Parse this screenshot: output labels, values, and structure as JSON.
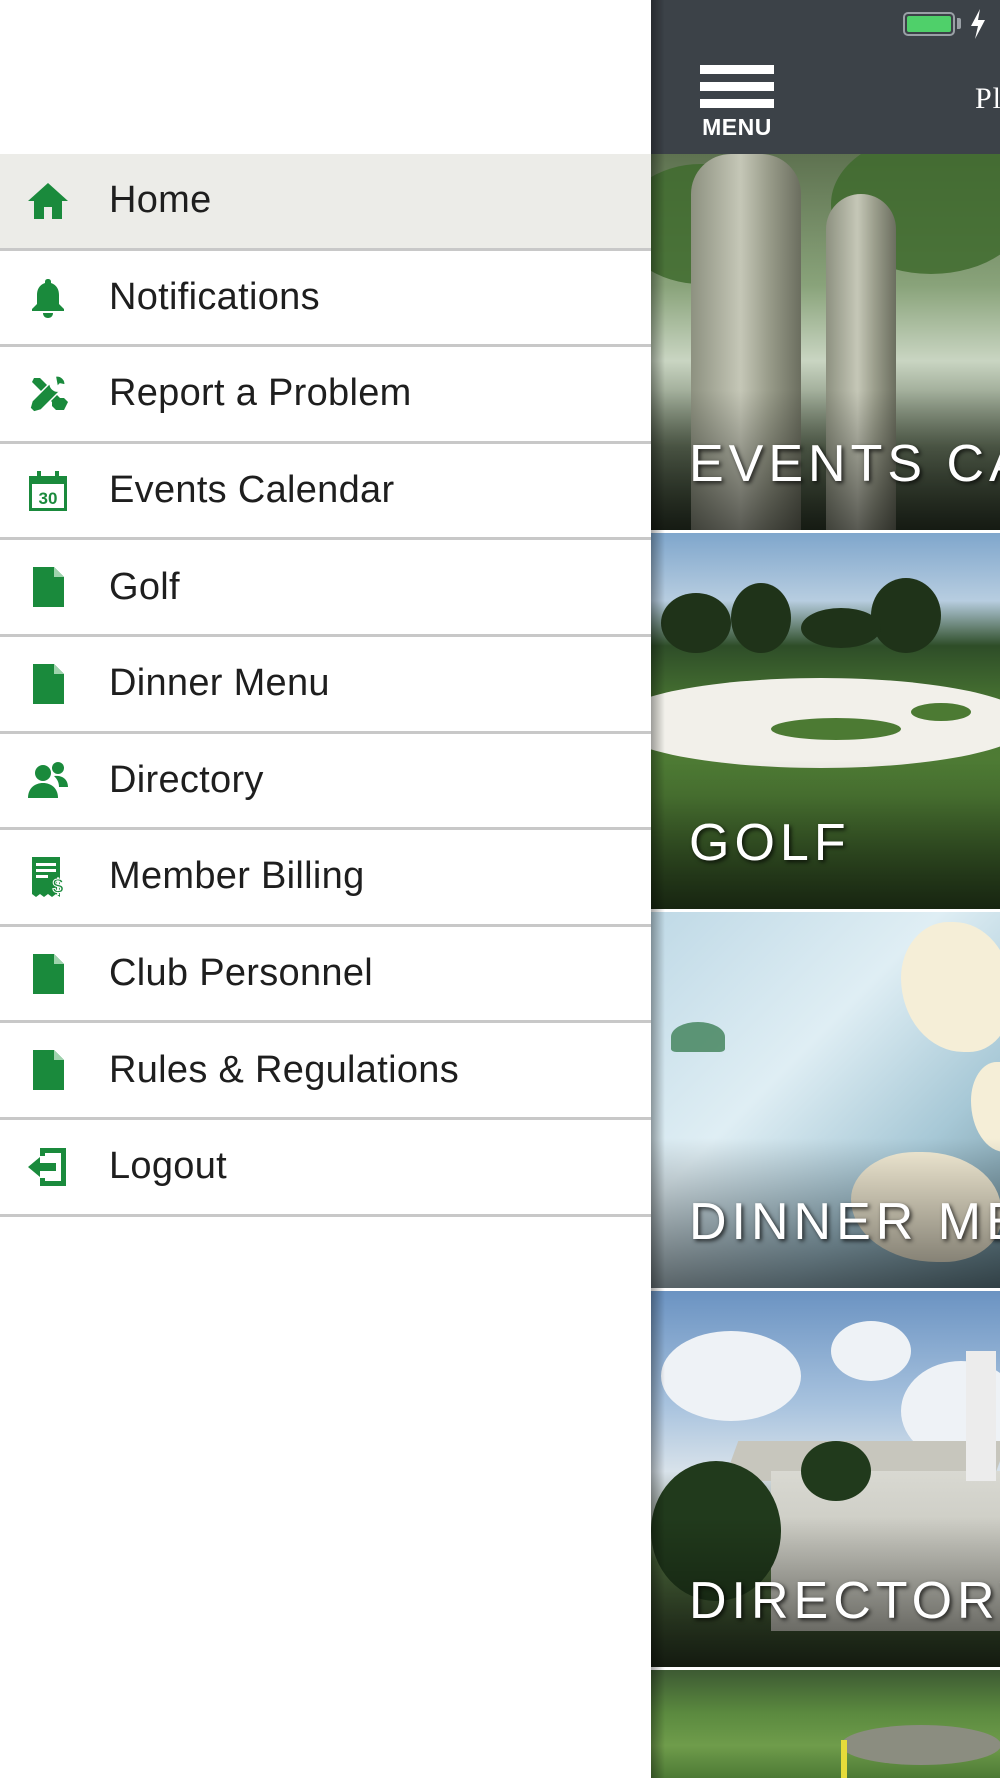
{
  "drawer": {
    "items": [
      {
        "label": "Home",
        "icon": "home-icon",
        "active": true
      },
      {
        "label": "Notifications",
        "icon": "bell-icon",
        "active": false
      },
      {
        "label": "Report a Problem",
        "icon": "tools-icon",
        "active": false
      },
      {
        "label": "Events Calendar",
        "icon": "calendar-icon",
        "active": false
      },
      {
        "label": "Golf",
        "icon": "document-icon",
        "active": false
      },
      {
        "label": "Dinner Menu",
        "icon": "document-icon",
        "active": false
      },
      {
        "label": "Directory",
        "icon": "people-icon",
        "active": false
      },
      {
        "label": "Member Billing",
        "icon": "billing-icon",
        "active": false
      },
      {
        "label": "Club Personnel",
        "icon": "document-icon",
        "active": false
      },
      {
        "label": "Rules & Regulations",
        "icon": "document-icon",
        "active": false
      },
      {
        "label": "Logout",
        "icon": "logout-icon",
        "active": false
      }
    ],
    "calendar_icon_day": "30"
  },
  "header": {
    "menu_label": "MENU",
    "title": "Pl"
  },
  "tiles": [
    {
      "label": "EVENTS CA"
    },
    {
      "label": "GOLF"
    },
    {
      "label": "DINNER ME"
    },
    {
      "label": "DIRECTORY"
    }
  ],
  "status_bar": {
    "battery_level": 1.0,
    "charging": true
  },
  "colors": {
    "accent_green": "#1a8a3c",
    "topbar": "#3c4248",
    "active_row": "#ecece8",
    "battery_fill": "#4fd06a"
  }
}
